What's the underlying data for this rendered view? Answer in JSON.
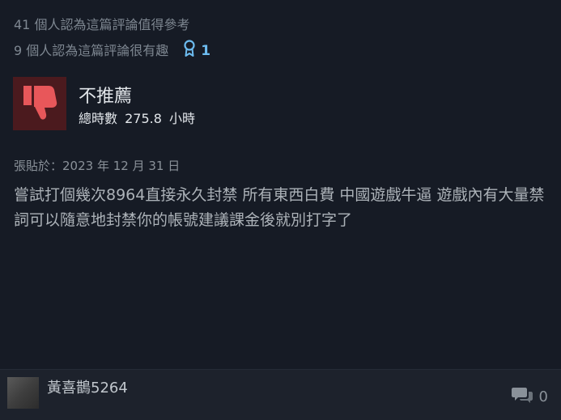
{
  "review": {
    "helpful_text": "41 個人認為這篇評論值得參考",
    "funny_text": "9 個人認為這篇評論很有趣",
    "award_icon": "award-ribbon-icon",
    "award_count": "1",
    "verdict_icon": "thumbs-down-icon",
    "verdict": "不推薦",
    "hours_label": "總時數",
    "hours_value": "275.8",
    "hours_unit": "小時",
    "posted": "張貼於：2023 年 12 月 31 日",
    "body": "嘗試打個幾次8964直接永久封禁 所有東西白費 中國遊戲牛逼 遊戲內有大量禁詞可以隨意地封禁你的帳號建議課金後就別打字了"
  },
  "footer": {
    "username": "黃喜鵲5264",
    "comment_icon": "comment-bubbles-icon",
    "comment_count": "0"
  },
  "colors": {
    "background": "#161b25",
    "footer_background": "#1d222c",
    "thumb_background": "#4b1a1e",
    "thumb_icon": "#e8575a",
    "award_accent": "#6dbcf0",
    "muted_text": "#7e8791",
    "body_text": "#acb2b8"
  }
}
